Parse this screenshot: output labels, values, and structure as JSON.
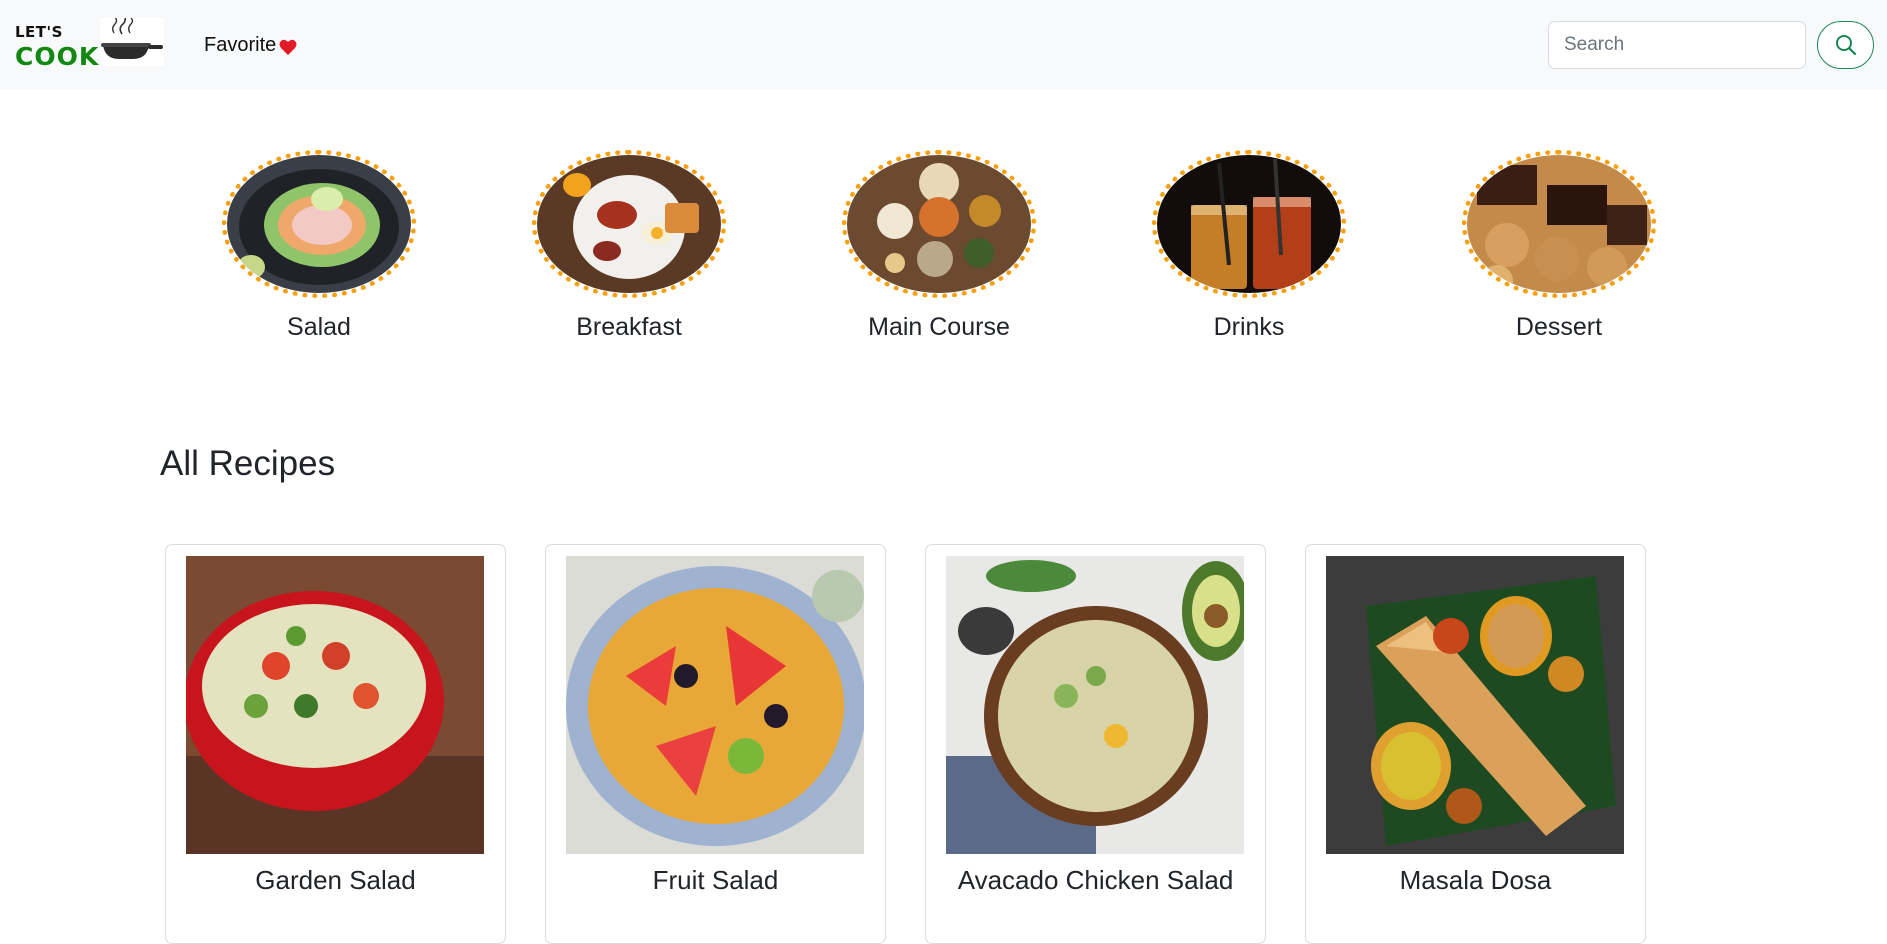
{
  "navbar": {
    "logo_top": "LET'S",
    "logo_bottom": "COOK",
    "favorite_label": "Favorite",
    "search_placeholder": "Search",
    "colors": {
      "brand_green": "#118811",
      "accent_outline": "#198754",
      "heart": "#e01b24"
    }
  },
  "categories": [
    {
      "label": "Salad"
    },
    {
      "label": "Breakfast"
    },
    {
      "label": "Main Course"
    },
    {
      "label": "Drinks"
    },
    {
      "label": "Dessert"
    }
  ],
  "categories_border_color": "#f7a00f",
  "recipes": {
    "title": "All Recipes",
    "items": [
      {
        "title": "Garden Salad"
      },
      {
        "title": "Fruit Salad"
      },
      {
        "title": "Avacado Chicken Salad"
      },
      {
        "title": "Masala Dosa"
      }
    ]
  }
}
